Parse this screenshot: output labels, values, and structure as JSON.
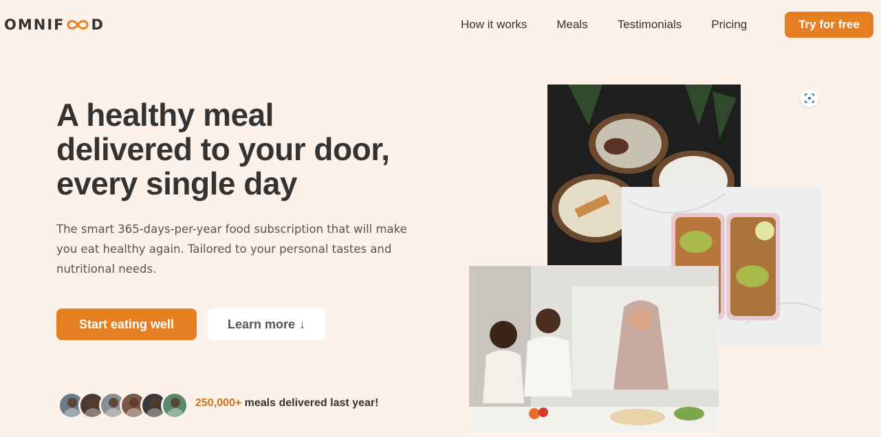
{
  "header": {
    "logo_left": "OMNIF",
    "logo_right": "D",
    "nav": [
      "How it works",
      "Meals",
      "Testimonials",
      "Pricing"
    ],
    "cta": "Try for free"
  },
  "hero": {
    "title_line1": "A healthy meal",
    "title_line2": "delivered to your door,",
    "title_line3": "every single day",
    "description": "The smart 365-days-per-year food subscription that will make you eat healthy again. Tailored to your personal tastes and nutritional needs.",
    "primary_button": "Start eating well",
    "secondary_button": "Learn more",
    "secondary_arrow": "↓",
    "delivered_count": "250,000+",
    "delivered_text": " meals delivered last year!"
  },
  "colors": {
    "background": "#fdf2e9",
    "accent": "#e67e22",
    "text": "#333333"
  },
  "avatars": [
    {
      "color": "#6b7b8a"
    },
    {
      "color": "#4a3b30"
    },
    {
      "color": "#8a8f93"
    },
    {
      "color": "#7a5a45"
    },
    {
      "color": "#3a3a3a"
    },
    {
      "color": "#5a8a6e"
    }
  ],
  "icons": {
    "logo": "infinity-icon",
    "scan": "scan-icon",
    "arrow": "arrow-down-icon"
  }
}
